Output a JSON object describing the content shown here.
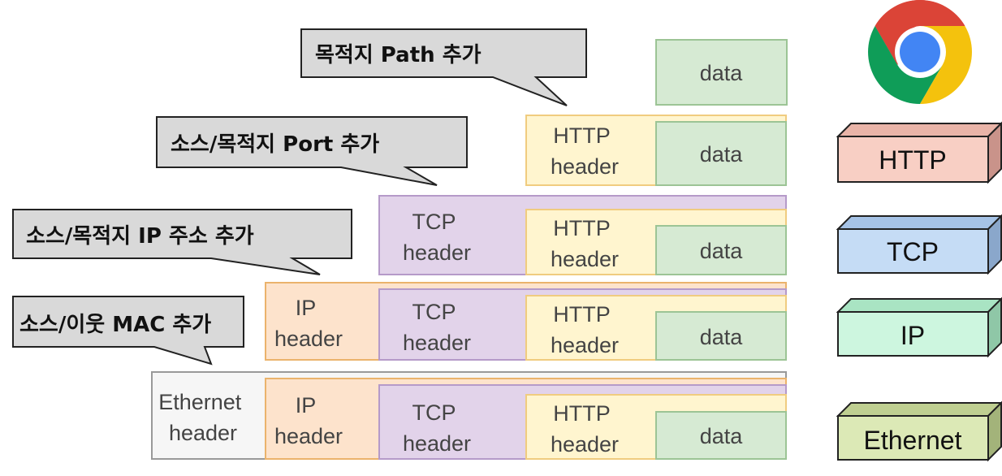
{
  "callouts": [
    "목적지 Path 추가",
    "소스/목적지 Port 추가",
    "소스/목적지 IP 주소 추가",
    "소스/이웃 MAC 추가"
  ],
  "cells": {
    "data": "data",
    "http": [
      "HTTP",
      "header"
    ],
    "tcp": [
      "TCP",
      "header"
    ],
    "ip": [
      "IP",
      "header"
    ],
    "ethernet": [
      "Ethernet",
      "header"
    ]
  },
  "layers": [
    "HTTP",
    "TCP",
    "IP",
    "Ethernet"
  ],
  "icons": {
    "browser": "chrome-browser-icon"
  },
  "colors": {
    "data_fill": "#d6ead3",
    "data_stroke": "#9cc495",
    "http_fill": "#fff5cf",
    "http_stroke": "#f0cc7f",
    "tcp_fill": "#e2d3ea",
    "tcp_stroke": "#b59ac9",
    "ip_fill": "#fde3cc",
    "ip_stroke": "#ebb36c",
    "eth_fill": "#f6f6f6",
    "eth_stroke": "#999999",
    "callout_fill": "#d9d9d9",
    "callout_stroke": "#222222",
    "layer_http": "#f8cfc4",
    "layer_tcp": "#c5dcf5",
    "layer_ip": "#cdf6df",
    "layer_eth": "#dce9b6"
  }
}
